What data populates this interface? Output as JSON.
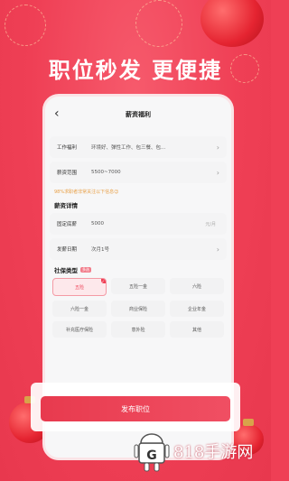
{
  "headline": "职位秒发 更便捷",
  "screen": {
    "title": "薪资福利",
    "rows": [
      {
        "label": "工作福利",
        "value": "环境好、弹性工作、包三餐、包..."
      },
      {
        "label": "薪资范围",
        "value": "5500~7000"
      }
    ],
    "notice": "98%求职者非常关注以下信息😉",
    "salary_section": {
      "title": "薪资详情"
    },
    "salary_rows": [
      {
        "label": "固定底薪",
        "value": "5000",
        "unit": "元/月"
      },
      {
        "label": "发薪日期",
        "value": "次月1号"
      }
    ],
    "insurance_section": {
      "title": "社保类型",
      "tag": "多选"
    },
    "insurance_options": [
      "五险",
      "五险一金",
      "六险",
      "六险一金",
      "商业保险",
      "企业年金",
      "补充医疗保险",
      "意外险",
      "其他"
    ],
    "selected_option": "五险"
  },
  "publish_button": "发布职位",
  "watermark": "818手游网",
  "colors": {
    "brand": "#ef3f55",
    "button": "#e83a4e"
  }
}
